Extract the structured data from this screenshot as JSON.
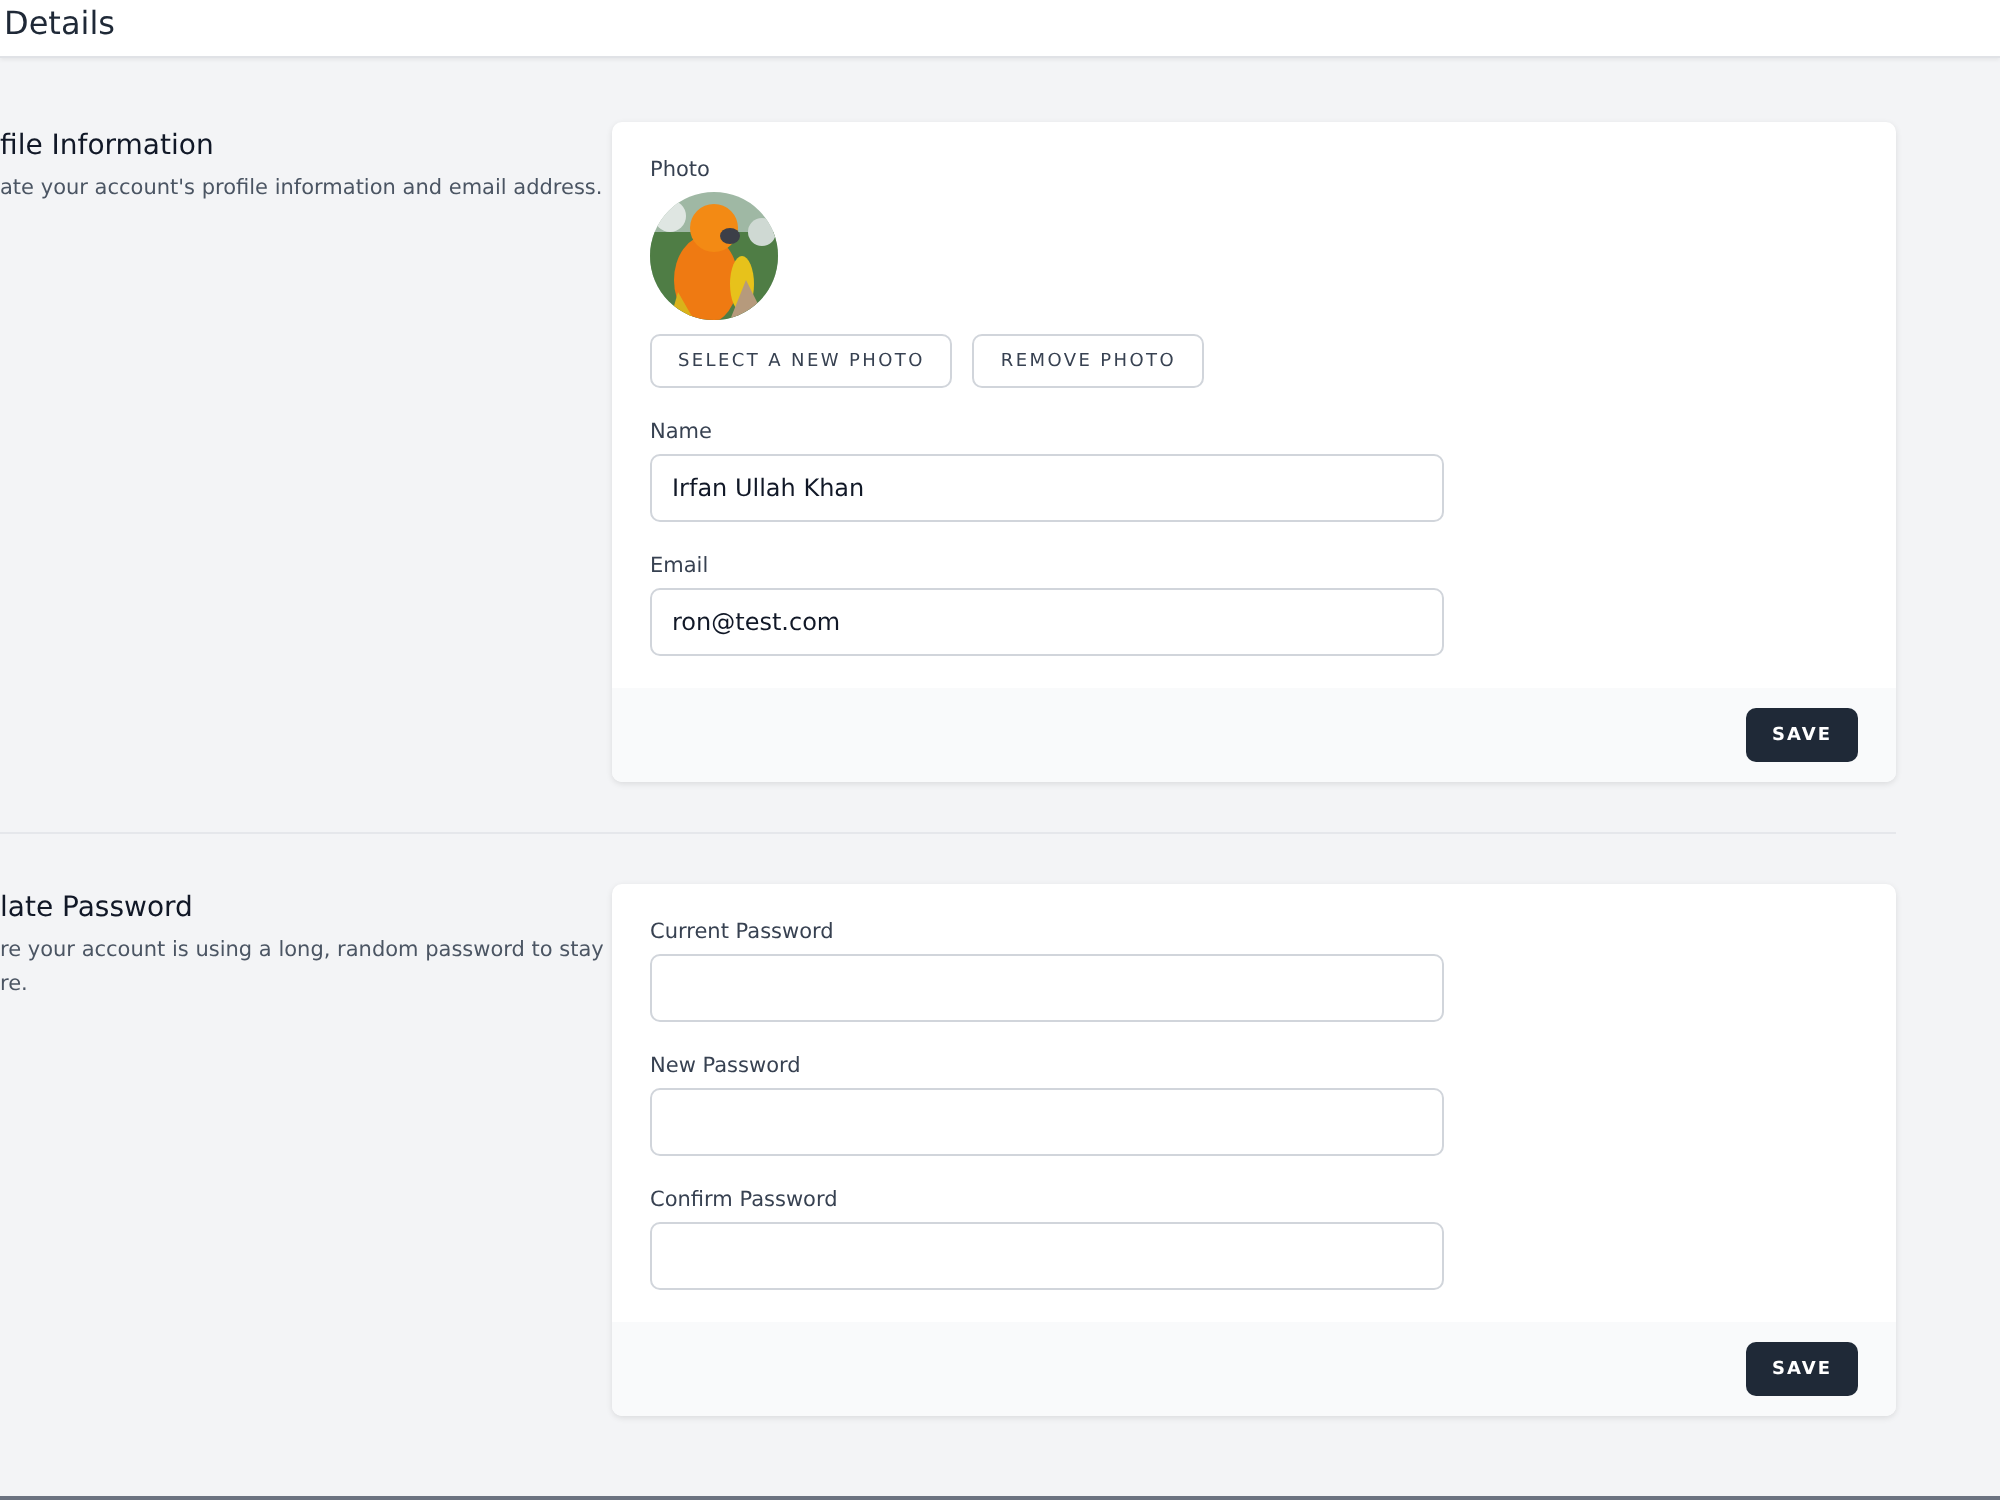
{
  "header": {
    "title": "Details"
  },
  "sections": [
    {
      "title": "file Information",
      "description": [
        "ate your account's profile information and email address."
      ],
      "photo": {
        "label": "Photo",
        "buttons": [
          "SELECT A NEW PHOTO",
          "REMOVE PHOTO"
        ]
      },
      "fields": [
        {
          "label": "Name",
          "value": "Irfan Ullah Khan"
        },
        {
          "label": "Email",
          "value": "ron@test.com"
        }
      ],
      "action": "SAVE"
    },
    {
      "title": "late Password",
      "description": [
        "re your account is using a long, random password to stay",
        "re."
      ],
      "fields": [
        {
          "label": "Current Password"
        },
        {
          "label": "New Password"
        },
        {
          "label": "Confirm Password"
        }
      ],
      "action": "SAVE"
    }
  ]
}
